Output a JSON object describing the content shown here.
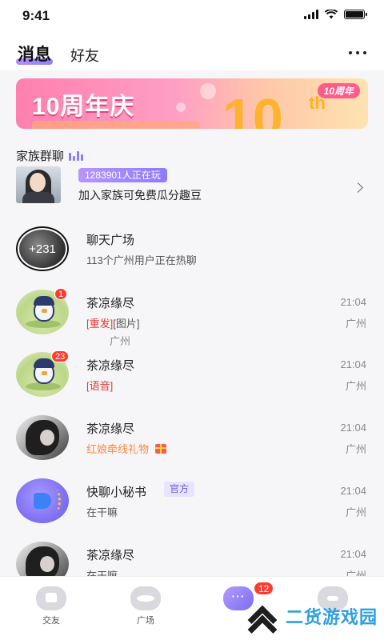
{
  "status": {
    "time": "9:41"
  },
  "header": {
    "tabs": [
      {
        "label": "消息",
        "active": true
      },
      {
        "label": "好友",
        "active": false
      }
    ],
    "accent": "#8c7bff"
  },
  "banner": {
    "title": "10周年庆",
    "big_number": "10",
    "suffix": "th",
    "badge": "10周年"
  },
  "family": {
    "section_label": "家族群聊",
    "online_count": "1283901人正在玩",
    "description": "加入家族可免费瓜分趣豆"
  },
  "chat_plaza": {
    "avatar_text": "+231",
    "name": "聊天广场",
    "subtitle": "113个广州用户正在热聊"
  },
  "conversations": [
    {
      "name": "茶凉缘尽",
      "badge": "1",
      "tags": [
        "[重发]"
      ],
      "preview": "[图片]",
      "time": "21:04",
      "city": "广州"
    },
    {
      "name": "茶凉缘尽",
      "badge": "23",
      "tags": [
        "[语音]"
      ],
      "preview": "",
      "time": "21:04",
      "city": "广州"
    },
    {
      "name": "茶凉缘尽",
      "badge": "",
      "tags": [],
      "preview": "红娘牵线礼物",
      "time": "21:04",
      "city": "广州"
    },
    {
      "name": "快聊小秘书",
      "badge": "",
      "official": "官方",
      "tags": [],
      "preview": "在干嘛",
      "time": "21:04",
      "city": "广州"
    },
    {
      "name": "茶凉缘尽",
      "badge": "",
      "tags": [],
      "preview": "在干嘛",
      "time": "21:04",
      "city": "广州"
    }
  ],
  "loose_city": "广州",
  "bottom_nav": {
    "items": [
      {
        "label": "交友"
      },
      {
        "label": "广场"
      },
      {
        "label": "",
        "badge": "12"
      },
      {
        "label": ""
      }
    ]
  },
  "watermark": {
    "text": "二货游戏园"
  }
}
